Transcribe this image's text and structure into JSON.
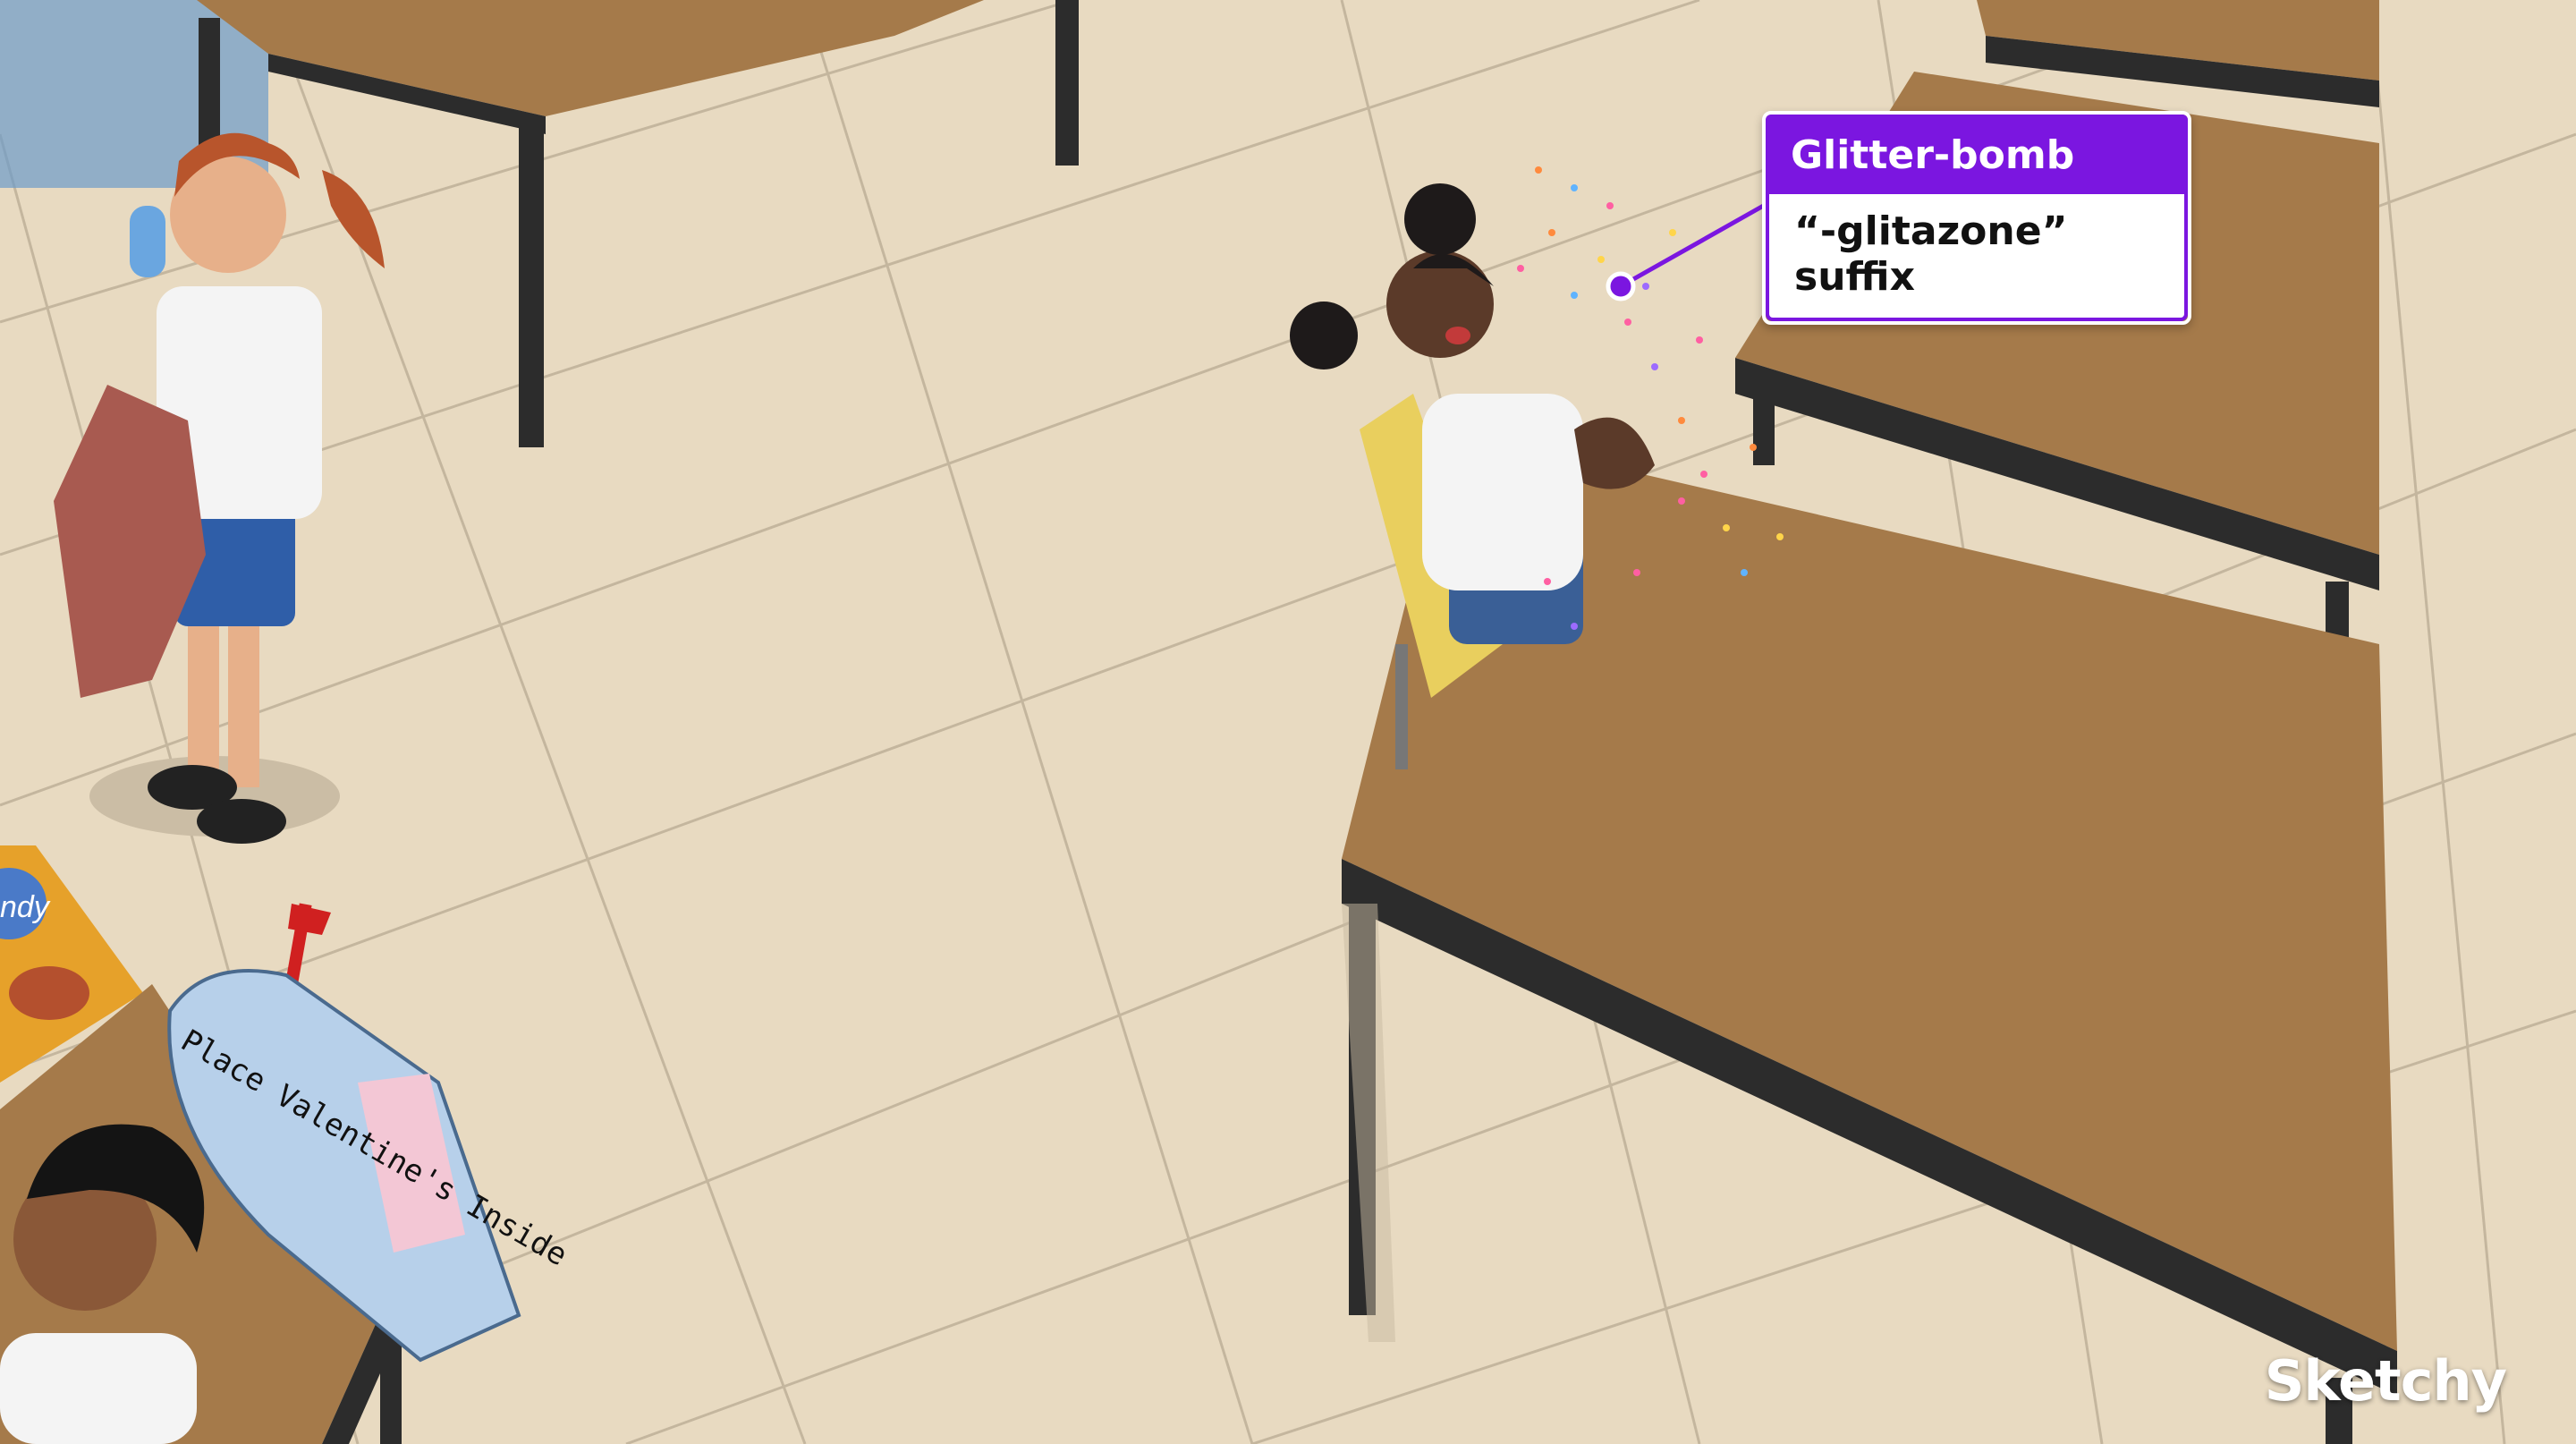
{
  "callout": {
    "title": "Glitter-bomb",
    "body": "“-glitazone” suffix"
  },
  "mailbox_label": "Place Valentine's Inside",
  "candy_label": "ndy",
  "brand": "Sketchy",
  "colors": {
    "accent": "#7b16e0",
    "floor": "#e9dcc4",
    "table": "#a57a4a"
  }
}
